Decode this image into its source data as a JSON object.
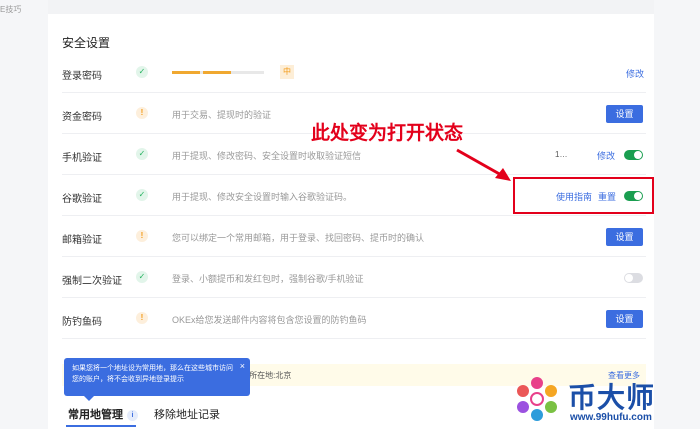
{
  "corner_text": "E技巧",
  "section_title": "安全设置",
  "rows": [
    {
      "label": "登录密码",
      "status": "ok",
      "strength": "中",
      "action": "修改"
    },
    {
      "label": "资金密码",
      "status": "warn",
      "desc": "用于交易、提现时的验证",
      "action": "设置"
    },
    {
      "label": "手机验证",
      "status": "ok",
      "desc": "用于提现、修改密码、安全设置时收取验证短信",
      "masked": "1…",
      "action": "修改",
      "toggle": "on"
    },
    {
      "label": "谷歌验证",
      "status": "ok",
      "desc": "用于提现、修改安全设置时输入谷歌验证码。",
      "guide": "使用指南",
      "action": "重置",
      "toggle": "on"
    },
    {
      "label": "邮箱验证",
      "status": "warn",
      "desc": "您可以绑定一个常用邮箱，用于登录、找回密码、提币时的确认",
      "action": "设置"
    },
    {
      "label": "强制二次验证",
      "status": "ok",
      "desc": "登录、小额提币和发红包时，强制谷歌/手机验证",
      "toggle": "off"
    },
    {
      "label": "防钓鱼码",
      "status": "warn",
      "desc": "OKEx给您发送邮件内容将包含您设置的防钓鱼码",
      "action": "设置"
    }
  ],
  "annotation": "此处变为打开状态",
  "info_bar": {
    "text": "04 所在地:北京",
    "more": "查看更多"
  },
  "tooltip": "如果您将一个地址设为常用地，那么在这些城市访问您的账户，将不会收到异地登录提示",
  "tabs": [
    {
      "label": "常用地管理",
      "info": "i"
    },
    {
      "label": "移除地址记录"
    }
  ],
  "watermark": {
    "brand": "币大师",
    "url": "www.99hufu.com"
  },
  "colors": {
    "accent": "#3b6de0",
    "success": "#1a9e50",
    "warning": "#f29a16",
    "annotation": "#e3001b"
  }
}
